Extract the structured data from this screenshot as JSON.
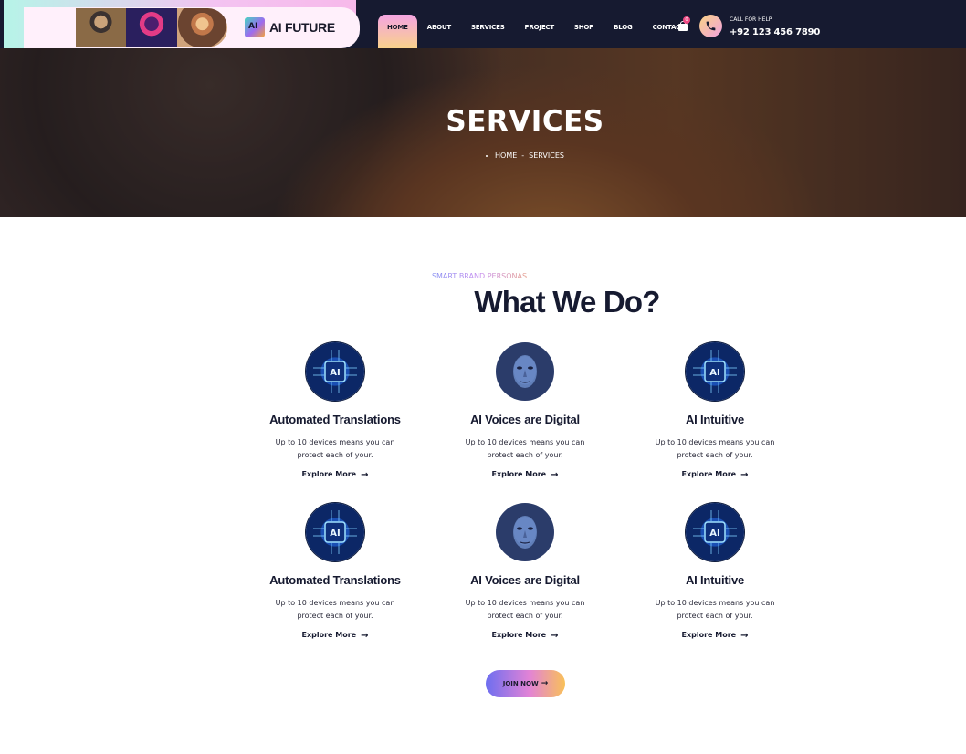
{
  "header": {
    "brand": "AI FUTURE",
    "nav": [
      {
        "label": "HOME",
        "active": true
      },
      {
        "label": "ABOUT",
        "active": false
      },
      {
        "label": "SERVICES",
        "active": false
      },
      {
        "label": "PROJECT",
        "active": false
      },
      {
        "label": "SHOP",
        "active": false
      },
      {
        "label": "BLOG",
        "active": false
      },
      {
        "label": "CONTACT",
        "active": false
      }
    ],
    "cart_count": "0",
    "help_label": "CALL FOR HELP",
    "help_number": "+92 123 456 7890"
  },
  "hero": {
    "title": "SERVICES",
    "breadcrumb": [
      "HOME",
      "SERVICES"
    ]
  },
  "section": {
    "eyebrow": "SMART BRAND PERSONAS",
    "title": "What We Do?"
  },
  "services": [
    {
      "icon": "ai-chip-icon",
      "title": "Automated Translations",
      "desc": "Up to 10 devices means you can protect each of your.",
      "link": "Explore More"
    },
    {
      "icon": "digital-face-icon",
      "title": "AI Voices are Digital",
      "desc": "Up to 10 devices means you can protect each of your.",
      "link": "Explore More"
    },
    {
      "icon": "ai-chip-icon",
      "title": "AI Intuitive",
      "desc": "Up to 10 devices means you can protect each of your.",
      "link": "Explore More"
    },
    {
      "icon": "ai-chip-icon",
      "title": "Automated Translations",
      "desc": "Up to 10 devices means you can protect each of your.",
      "link": "Explore More"
    },
    {
      "icon": "digital-face-icon",
      "title": "AI Voices are Digital",
      "desc": "Up to 10 devices means you can protect each of your.",
      "link": "Explore More"
    },
    {
      "icon": "ai-chip-icon",
      "title": "AI Intuitive",
      "desc": "Up to 10 devices means you can protect each of your.",
      "link": "Explore More"
    }
  ],
  "cta": {
    "label": "JOIN NOW"
  },
  "colors": {
    "navy": "#161a30",
    "gradient_start": "#6d6ef0",
    "gradient_mid": "#e283d6",
    "gradient_end": "#f9c158"
  }
}
